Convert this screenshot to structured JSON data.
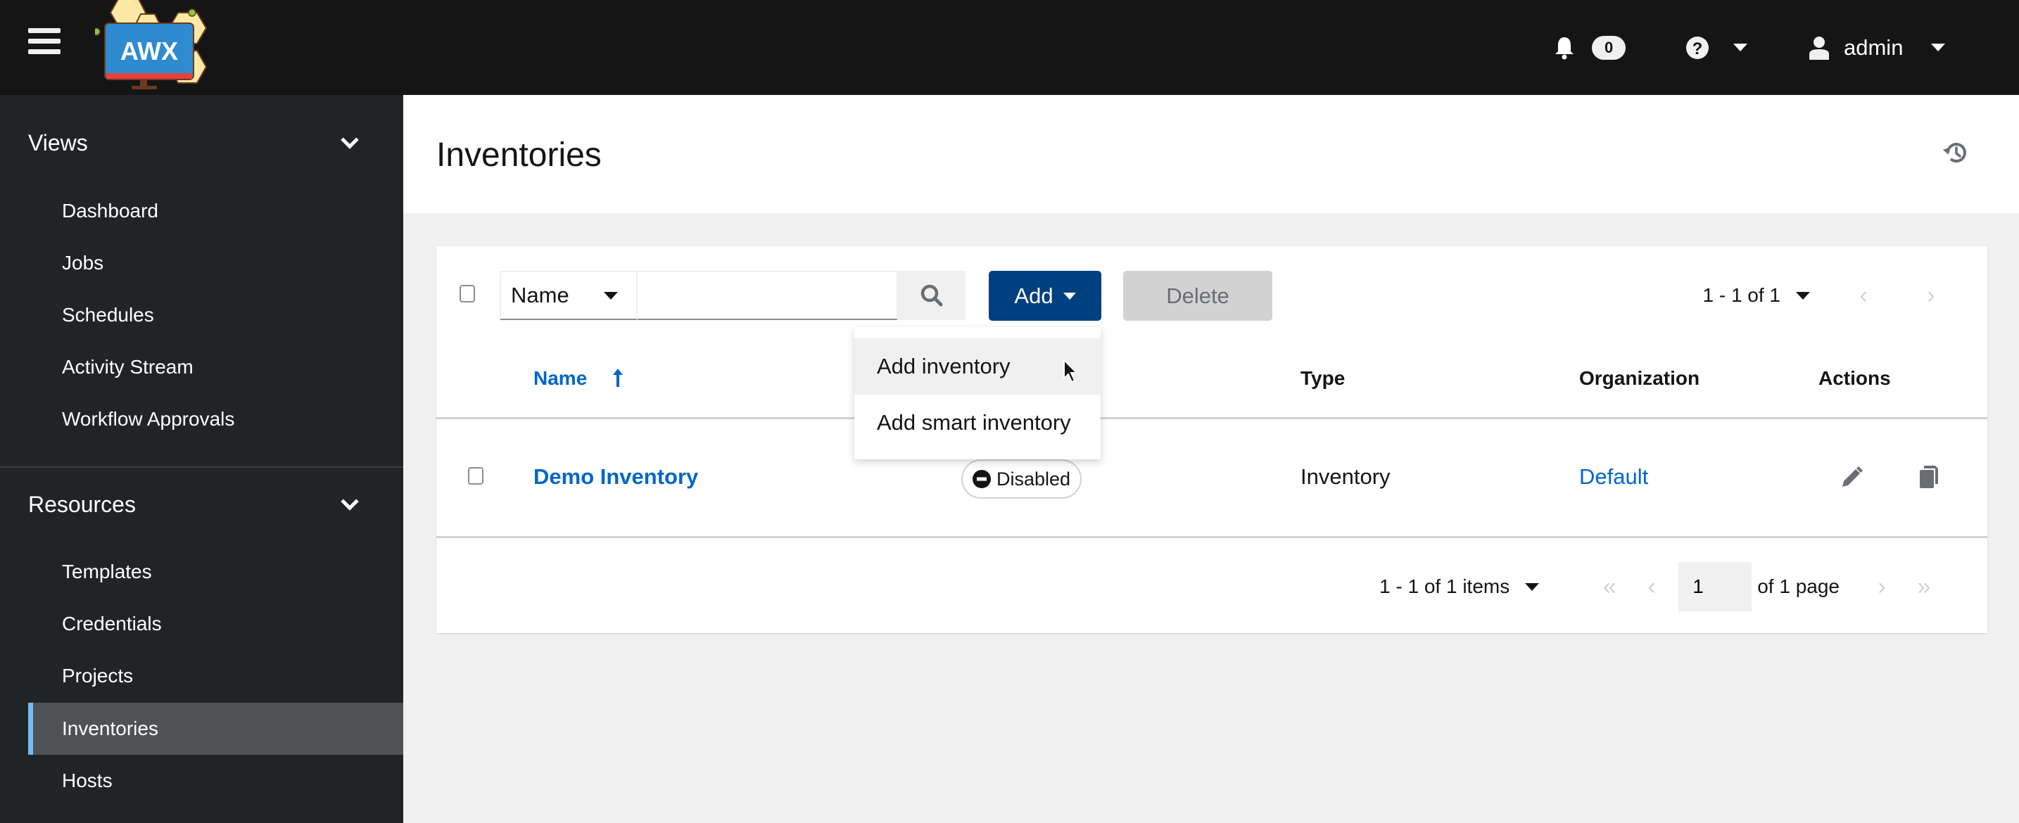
{
  "header": {
    "logo_text": "AWX",
    "notification_count": "0",
    "username": "admin",
    "icons": [
      "hamburger-menu-icon",
      "bell-icon",
      "question-circle-icon",
      "user-icon",
      "caret-down-icon"
    ]
  },
  "sidebar": {
    "groups": [
      {
        "title": "Views",
        "items": [
          {
            "label": "Dashboard"
          },
          {
            "label": "Jobs"
          },
          {
            "label": "Schedules"
          },
          {
            "label": "Activity Stream"
          },
          {
            "label": "Workflow Approvals"
          }
        ]
      },
      {
        "title": "Resources",
        "items": [
          {
            "label": "Templates"
          },
          {
            "label": "Credentials"
          },
          {
            "label": "Projects"
          },
          {
            "label": "Inventories",
            "active": true
          },
          {
            "label": "Hosts"
          }
        ]
      }
    ]
  },
  "page": {
    "title": "Inventories"
  },
  "toolbar": {
    "filter_field": "Name",
    "search_value": "",
    "add_label": "Add",
    "delete_label": "Delete",
    "pagination_summary": "1 - 1 of 1"
  },
  "add_menu": {
    "items": [
      {
        "label": "Add inventory"
      },
      {
        "label": "Add smart inventory"
      }
    ]
  },
  "table": {
    "columns": [
      "Name",
      "Type",
      "Organization",
      "Actions"
    ],
    "sort": {
      "column": "Name",
      "direction": "ascending"
    },
    "rows": [
      {
        "name": "Demo Inventory",
        "status": "Disabled",
        "type": "Inventory",
        "organization": "Default"
      }
    ]
  },
  "pagination": {
    "items_summary": "1 - 1 of 1 items",
    "current_page": "1",
    "total_pages_label": "of 1 page"
  },
  "colors": {
    "masthead": "#151515",
    "sidebar": "#212427",
    "sidebar_active": "#4f5255",
    "active_indicator": "#73bcf7",
    "primary_button": "#004080",
    "link": "#0066cc",
    "disabled_button": "#d2d2d2"
  }
}
